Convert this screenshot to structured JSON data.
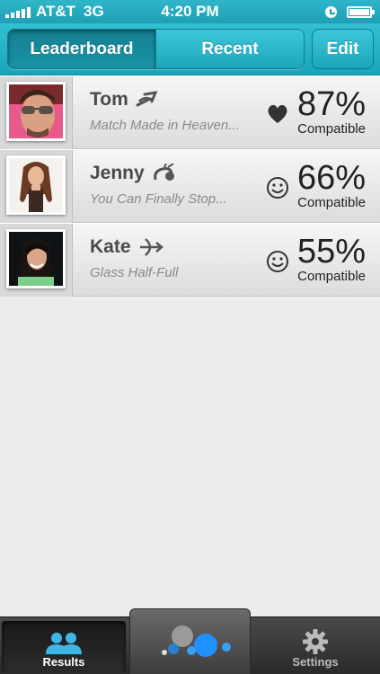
{
  "status_bar": {
    "carrier": "AT&T",
    "network": "3G",
    "time": "4:20 PM"
  },
  "nav": {
    "segments": [
      {
        "label": "Leaderboard",
        "selected": true
      },
      {
        "label": "Recent",
        "selected": false
      }
    ],
    "edit_label": "Edit"
  },
  "matches": [
    {
      "name": "Tom",
      "zodiac_icon": "sagittarius-icon",
      "tagline": "Match Made in Heaven...",
      "mood_icon": "heart-icon",
      "percent": "87%",
      "compat_label": "Compatible"
    },
    {
      "name": "Jenny",
      "zodiac_icon": "capricorn-icon",
      "tagline": "You Can Finally Stop...",
      "mood_icon": "smiley-icon",
      "percent": "66%",
      "compat_label": "Compatible"
    },
    {
      "name": "Kate",
      "zodiac_icon": "sagittarius-icon",
      "tagline": "Glass Half-Full",
      "mood_icon": "smiley-icon",
      "percent": "55%",
      "compat_label": "Compatible"
    }
  ],
  "tab_bar": {
    "results_label": "Results",
    "settings_label": "Settings",
    "active": "results"
  },
  "colors": {
    "accent": "#1aa4b9",
    "tab_active_icon": "#3fb7e6"
  }
}
